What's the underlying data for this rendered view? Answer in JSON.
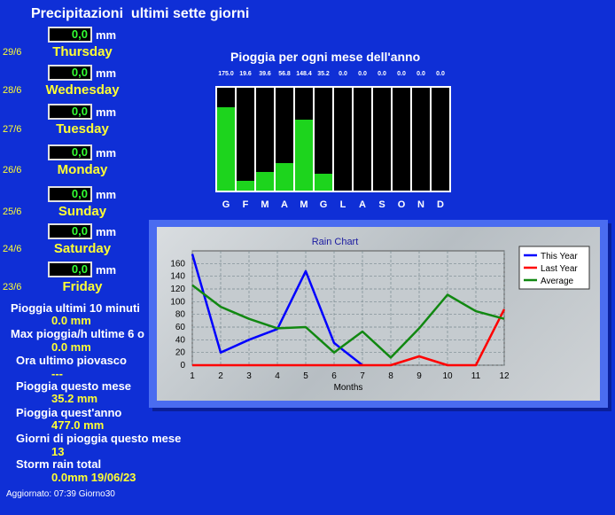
{
  "page": {
    "title": "Precipitazioni  ultimi sette giorni",
    "updated": "Aggiornato: 07:39 Giorno30"
  },
  "days": [
    {
      "date": "29/6",
      "value": "0,0",
      "unit": "mm",
      "name": "Thursday"
    },
    {
      "date": "28/6",
      "value": "0,0",
      "unit": "mm",
      "name": "Wednesday"
    },
    {
      "date": "27/6",
      "value": "0,0",
      "unit": "mm",
      "name": "Tuesday"
    },
    {
      "date": "26/6",
      "value": "0,0",
      "unit": "mm",
      "name": "Monday"
    },
    {
      "date": "25/6",
      "value": "0,0",
      "unit": "mm",
      "name": "Sunday"
    },
    {
      "date": "24/6",
      "value": "0,0",
      "unit": "mm",
      "name": "Saturday"
    },
    {
      "date": "23/6",
      "value": "0,0",
      "unit": "mm",
      "name": "Friday"
    }
  ],
  "stats": [
    {
      "label": "Pioggia ultimi 10 minuti",
      "value": "0.0 mm"
    },
    {
      "label": "Max pioggia/h ultime 6 o",
      "value": "0.0 mm"
    },
    {
      "label": "Ora ultimo piovasco",
      "value": "---"
    },
    {
      "label": "Pioggia questo mese",
      "value": "35.2 mm"
    },
    {
      "label": "Pioggia quest'anno",
      "value": "477.0 mm"
    },
    {
      "label": "Giorni di pioggia questo mese",
      "value": "13"
    },
    {
      "label": "Storm rain total",
      "value": "0.0mm 19/06/23"
    }
  ],
  "monthly": {
    "title": "Pioggia per ogni mese dell'anno",
    "labels": [
      "G",
      "F",
      "M",
      "A",
      "M",
      "G",
      "L",
      "A",
      "S",
      "O",
      "N",
      "D"
    ],
    "values": [
      "175.0",
      "19.6",
      "39.6",
      "56.8",
      "148.4",
      "35.2",
      "0.0",
      "0.0",
      "0.0",
      "0.0",
      "0.0",
      "0.0"
    ],
    "max": 215,
    "bar_color": "#1dd41d"
  },
  "chart_data": {
    "type": "line",
    "title": "Rain Chart",
    "xlabel": "Months",
    "ylabel": "",
    "x": [
      1,
      2,
      3,
      4,
      5,
      6,
      7,
      8,
      9,
      10,
      11,
      12
    ],
    "ylim": [
      0,
      180
    ],
    "yticks": [
      0,
      20,
      40,
      60,
      80,
      100,
      120,
      140,
      160
    ],
    "grid": true,
    "legend_position": "top-right",
    "series": [
      {
        "name": "This Year",
        "color": "#0000ff",
        "values": [
          175,
          20,
          40,
          57,
          148,
          35,
          0,
          null,
          null,
          null,
          null,
          null
        ]
      },
      {
        "name": "Last Year",
        "color": "#ff0000",
        "values": [
          0,
          0,
          0,
          0,
          0,
          0,
          0,
          0,
          14,
          0,
          0,
          88
        ]
      },
      {
        "name": "Average",
        "color": "#118811",
        "values": [
          126,
          92,
          73,
          58,
          60,
          20,
          53,
          12,
          58,
          111,
          85,
          73
        ]
      }
    ]
  }
}
